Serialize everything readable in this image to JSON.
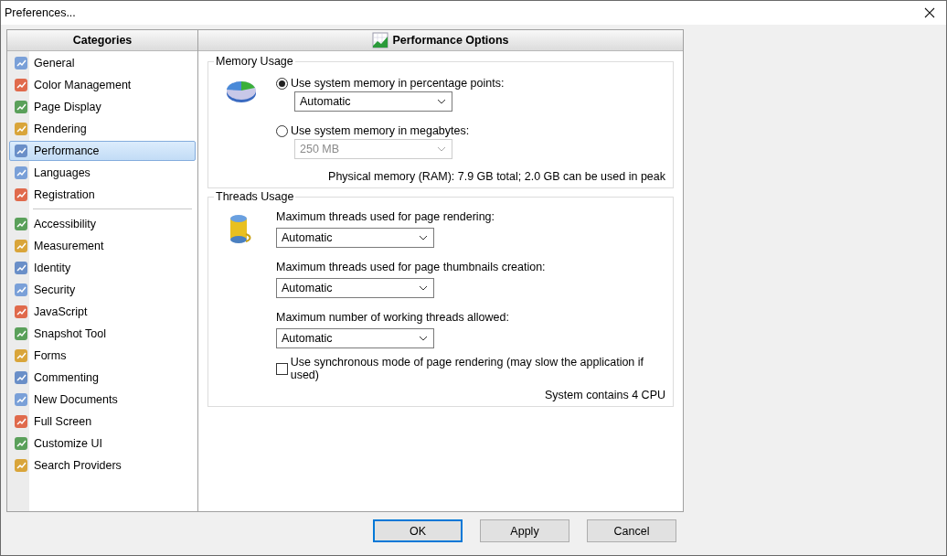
{
  "window": {
    "title": "Preferences..."
  },
  "sidebar": {
    "title": "Categories",
    "groups": [
      [
        {
          "label": "General",
          "selected": false
        },
        {
          "label": "Color Management",
          "selected": false
        },
        {
          "label": "Page Display",
          "selected": false
        },
        {
          "label": "Rendering",
          "selected": false
        },
        {
          "label": "Performance",
          "selected": true
        },
        {
          "label": "Languages",
          "selected": false
        },
        {
          "label": "Registration",
          "selected": false
        }
      ],
      [
        {
          "label": "Accessibility",
          "selected": false
        },
        {
          "label": "Measurement",
          "selected": false
        },
        {
          "label": "Identity",
          "selected": false
        },
        {
          "label": "Security",
          "selected": false
        },
        {
          "label": "JavaScript",
          "selected": false
        },
        {
          "label": "Snapshot Tool",
          "selected": false
        },
        {
          "label": "Forms",
          "selected": false
        },
        {
          "label": "Commenting",
          "selected": false
        },
        {
          "label": "New Documents",
          "selected": false
        },
        {
          "label": "Full Screen",
          "selected": false
        },
        {
          "label": "Customize UI",
          "selected": false
        },
        {
          "label": "Search Providers",
          "selected": false
        }
      ]
    ]
  },
  "panel": {
    "title": "Performance Options",
    "memory": {
      "title": "Memory Usage",
      "options": [
        {
          "label": "Use system memory in percentage points:",
          "selected": true,
          "dropdown": {
            "value": "Automatic",
            "disabled": false
          }
        },
        {
          "label": "Use system memory in megabytes:",
          "selected": false,
          "dropdown": {
            "value": "250 MB",
            "disabled": true
          }
        }
      ],
      "info": "Physical memory (RAM): 7.9 GB total; 2.0 GB can be used in peak"
    },
    "threads": {
      "title": "Threads Usage",
      "fields": [
        {
          "label": "Maximum threads used for page rendering:",
          "value": "Automatic"
        },
        {
          "label": "Maximum threads used for page thumbnails creation:",
          "value": "Automatic"
        },
        {
          "label": "Maximum number of working threads allowed:",
          "value": "Automatic"
        }
      ],
      "checkbox": {
        "label": "Use synchronous mode of page rendering (may slow the application if used)",
        "checked": false
      },
      "info": "System contains 4 CPU"
    }
  },
  "buttons": [
    {
      "label": "OK",
      "default": true
    },
    {
      "label": "Apply",
      "default": false
    },
    {
      "label": "Cancel",
      "default": false
    }
  ]
}
